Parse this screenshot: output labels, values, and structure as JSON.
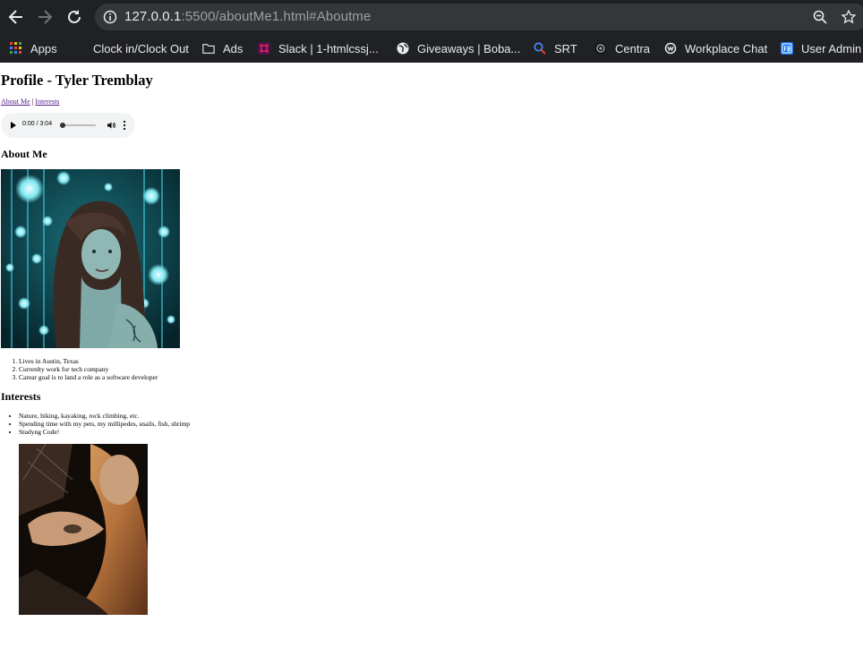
{
  "browser": {
    "url_host": "127.0.0.1",
    "url_rest": ":5500/aboutMe1.html#Aboutme",
    "bookmarks": [
      {
        "label": "Apps",
        "icon": "apps-grid-icon"
      },
      {
        "label": "Clock in/Clock Out",
        "icon": "blank-page-icon"
      },
      {
        "label": "Ads",
        "icon": "folder-icon"
      },
      {
        "label": "Slack | 1-htmlcssj...",
        "icon": "slack-icon"
      },
      {
        "label": "Giveaways | Boba...",
        "icon": "globe-icon"
      },
      {
        "label": "SRT",
        "icon": "search-magnifier-icon"
      },
      {
        "label": "Centra",
        "icon": "centra-icon"
      },
      {
        "label": "Workplace Chat",
        "icon": "workplace-icon"
      },
      {
        "label": "User Admin",
        "icon": "fb-icon"
      }
    ]
  },
  "page": {
    "title": "Profile - Tyler Tremblay",
    "nav": {
      "about_link": "About Me",
      "separator": "|",
      "interests_link": "Interests"
    },
    "audio": {
      "time": "0:00 / 3:04",
      "progress": 0
    },
    "about_heading": "About Me",
    "about_items": [
      "Lives in Austin, Texas",
      "Currenlty work for tech company",
      "Carear goal is to land a role as a software developer"
    ],
    "interests_heading": "Interests",
    "interests_items": [
      "Nature, hiking, kayaking, rock climbing, etc.",
      "Spending time with my pets, my millipedes, snails, fish, shrimp",
      "Studyng Code!"
    ]
  },
  "colors": {
    "chrome_bg": "#202124",
    "omnibox_bg": "#35363a",
    "visited_link": "#551a8b",
    "photo1_tint": "#1fb3c4"
  }
}
